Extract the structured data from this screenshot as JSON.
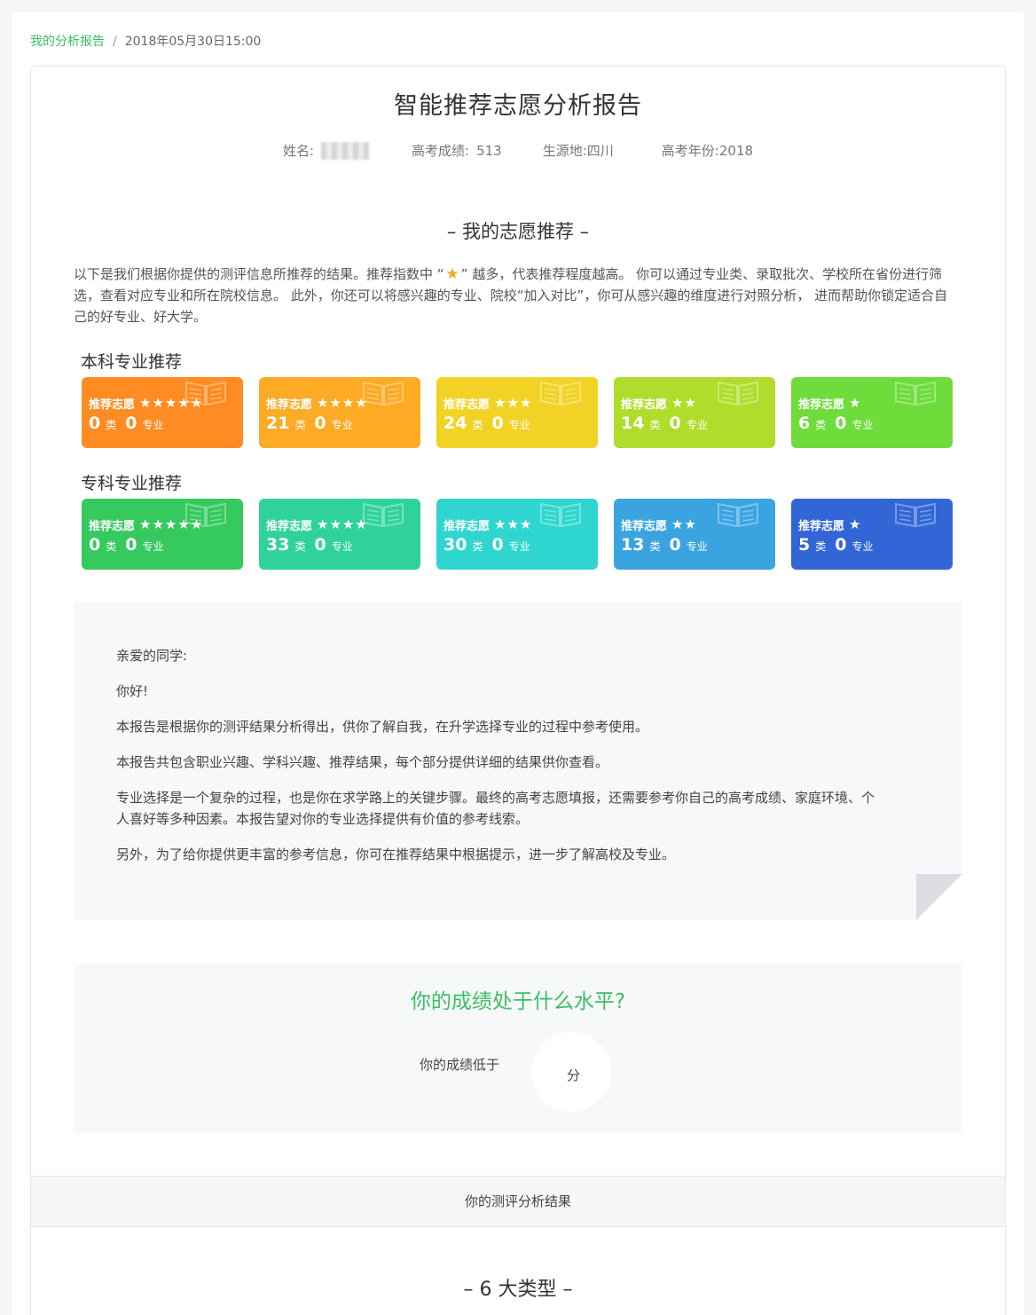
{
  "breadcrumb": {
    "link": "我的分析报告",
    "separator": "/",
    "current": "2018年05月30日15:00"
  },
  "report": {
    "title": "智能推荐志愿分析报告",
    "meta": {
      "name_label": "姓名:",
      "score_label": "高考成绩:",
      "score_value": "513",
      "origin_label": "生源地:",
      "origin_value": "四川",
      "year_label": "高考年份:",
      "year_value": "2018"
    }
  },
  "recommend": {
    "heading": "– 我的志愿推荐 –",
    "intro_before_star": "以下是我们根据你提供的测评信息所推荐的结果。推荐指数中 “",
    "intro_star": "★",
    "intro_after_star": "” 越多，代表推荐程度越高。 你可以通过专业类、录取批次、学校所在省份进行筛选，查看对应专业和所在院校信息。 此外，你还可以将感兴趣的专业、院校“加入对比”，你可从感兴趣的维度进行对照分析， 进而帮助你锁定适合自己的好专业、好大学。",
    "undergrad_label": "本科专业推荐",
    "vocational_label": "专科专业推荐",
    "card_title": "推荐志愿",
    "category_unit": "类",
    "major_unit": "专业",
    "undergrad_cards": [
      {
        "stars": "★★★★★",
        "categories": "0",
        "majors": "0",
        "color": "#fe8c22"
      },
      {
        "stars": "★★★★",
        "categories": "21",
        "majors": "0",
        "color": "#fdaa24"
      },
      {
        "stars": "★★★",
        "categories": "24",
        "majors": "0",
        "color": "#f2d325"
      },
      {
        "stars": "★★",
        "categories": "14",
        "majors": "0",
        "color": "#b0dc2b"
      },
      {
        "stars": "★",
        "categories": "6",
        "majors": "0",
        "color": "#6edc3a"
      }
    ],
    "vocational_cards": [
      {
        "stars": "★★★★★",
        "categories": "0",
        "majors": "0",
        "color": "#35c95e"
      },
      {
        "stars": "★★★★",
        "categories": "33",
        "majors": "0",
        "color": "#2fd39a"
      },
      {
        "stars": "★★★",
        "categories": "30",
        "majors": "0",
        "color": "#2ed6cf"
      },
      {
        "stars": "★★",
        "categories": "13",
        "majors": "0",
        "color": "#3aa4e0"
      },
      {
        "stars": "★",
        "categories": "5",
        "majors": "0",
        "color": "#3266d6"
      }
    ]
  },
  "letter": {
    "greeting": "亲爱的同学:",
    "hello": "你好!",
    "p1": "本报告是根据你的测评结果分析得出，供你了解自我，在升学选择专业的过程中参考使用。",
    "p2": "本报告共包含职业兴趣、学科兴趣、推荐结果，每个部分提供详细的结果供你查看。",
    "p3": "专业选择是一个复杂的过程，也是你在求学路上的关键步骤。最终的高考志愿填报，还需要参考你自己的高考成绩、家庭环境、个人喜好等多种因素。本报告望对你的专业选择提供有价值的参考线索。",
    "p4": "另外，为了给你提供更丰富的参考信息，你可在推荐结果中根据提示，进一步了解高校及专业。"
  },
  "score_level": {
    "title": "你的成绩处于什么水平?",
    "label": "你的成绩低于",
    "unit": "分"
  },
  "analysis": {
    "bar_label": "你的测评分析结果",
    "types_heading": "– 6 大类型 –"
  },
  "colors": {
    "accent": "#3bbf63",
    "panel_bg": "#f7f8fa"
  },
  "icons": {
    "card_decoration": "book-icon",
    "inline_star": "star-icon"
  }
}
